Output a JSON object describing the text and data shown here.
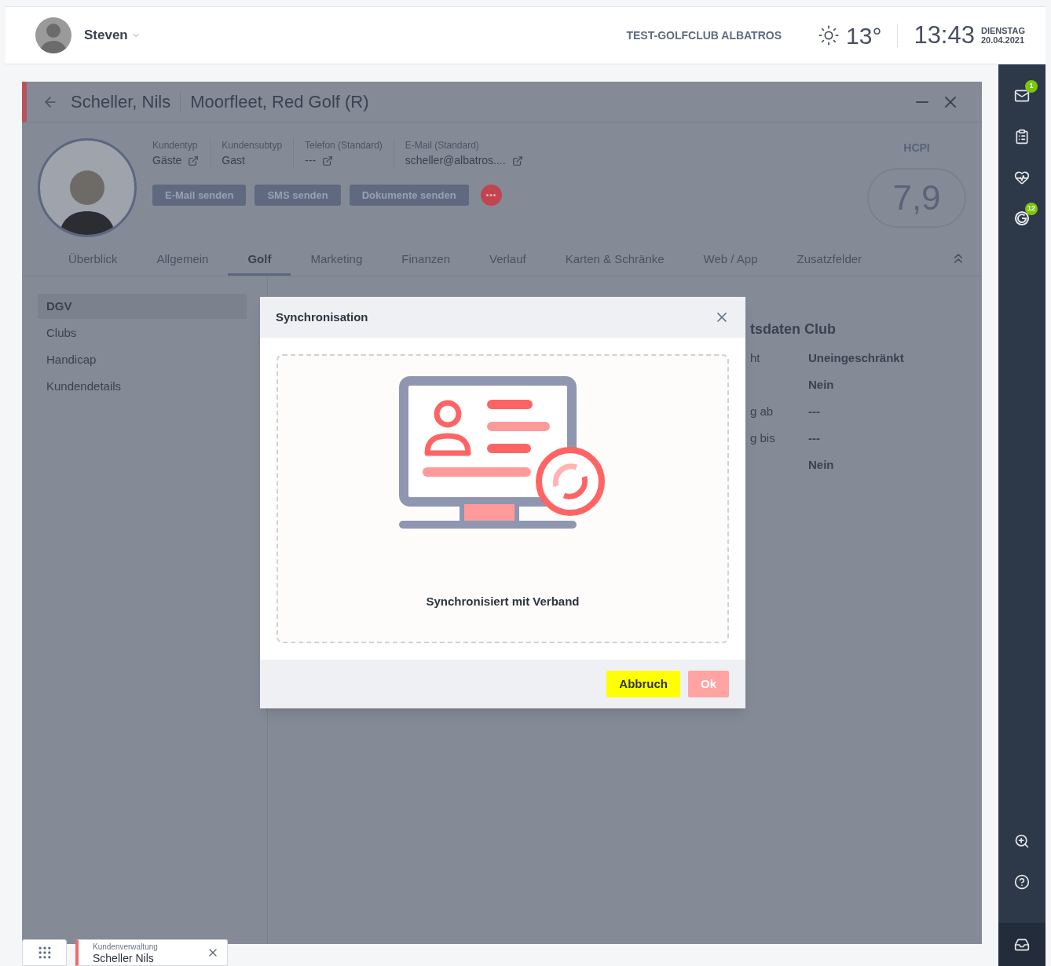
{
  "topbar": {
    "user": "Steven",
    "club": "TEST-GOLFCLUB ALBATROS",
    "temperature": "13°",
    "time": "13:43",
    "weekday": "DIENSTAG",
    "date": "20.04.2021"
  },
  "customer": {
    "name": "Scheller, Nils",
    "club": "Moorfleet, Red Golf (R)",
    "fields": [
      {
        "label": "Kundentyp",
        "value": "Gäste",
        "link": true
      },
      {
        "label": "Kundensubtyp",
        "value": "Gast",
        "link": false
      },
      {
        "label": "Telefon (Standard)",
        "value": "---",
        "link": true
      },
      {
        "label": "E-Mail (Standard)",
        "value": "scheller@albatros....",
        "link": true
      }
    ],
    "actions": [
      "E-Mail senden",
      "SMS senden",
      "Dokumente senden"
    ],
    "hcpi_label": "HCPI",
    "hcpi": "7,9"
  },
  "tabs": [
    {
      "label": "Überblick",
      "selected": false
    },
    {
      "label": "Allgemein",
      "selected": false
    },
    {
      "label": "Golf",
      "selected": true
    },
    {
      "label": "Marketing",
      "selected": false
    },
    {
      "label": "Finanzen",
      "selected": false
    },
    {
      "label": "Verlauf",
      "selected": false
    },
    {
      "label": "Karten & Schränke",
      "selected": false
    },
    {
      "label": "Web / App",
      "selected": false
    },
    {
      "label": "Zusatzfelder",
      "selected": false
    }
  ],
  "subnav": [
    {
      "label": "DGV",
      "selected": true
    },
    {
      "label": "Clubs",
      "selected": false
    },
    {
      "label": "Handicap",
      "selected": false
    },
    {
      "label": "Kundendetails",
      "selected": false
    }
  ],
  "section": {
    "heading": "tsdaten Club",
    "rows": [
      {
        "label": "ht",
        "value": "Uneingeschränkt"
      },
      {
        "label": "",
        "value": "Nein"
      },
      {
        "label": "g ab",
        "value": "---"
      },
      {
        "label": "g bis",
        "value": "---"
      },
      {
        "label": "",
        "value": "Nein"
      }
    ]
  },
  "dialog": {
    "title": "Synchronisation",
    "message": "Synchronisiert mit Verband",
    "buttons": [
      {
        "label": "Abbruch",
        "disabled": false
      },
      {
        "label": "Ok",
        "disabled": true
      }
    ]
  },
  "sidebar": [
    {
      "kind": "mail",
      "badge": "1"
    },
    {
      "kind": "clipboard"
    },
    {
      "kind": "heart"
    },
    {
      "kind": "g",
      "badge": "12"
    }
  ],
  "taskbar": {
    "module": "Kundenverwaltung",
    "title": "Scheller Nils"
  }
}
